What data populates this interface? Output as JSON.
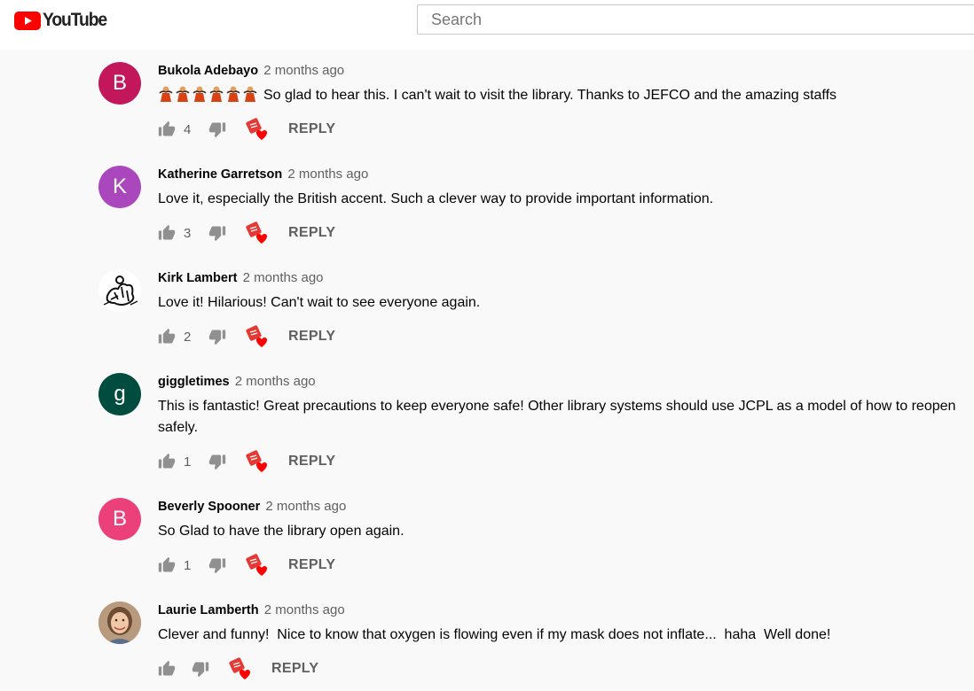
{
  "header": {
    "logo_text": "YouTube",
    "search_placeholder": "Search"
  },
  "labels": {
    "reply": "REPLY"
  },
  "comments": [
    {
      "avatar_letter": "B",
      "avatar_color": "#c2185b",
      "author": "Bukola Adebayo",
      "published": "2 months ago",
      "text": "So glad to hear this. I can't wait to visit the library. Thanks to JEFCO and the amazing staffs",
      "emoji_prefix": [
        "person-emoji",
        "person-emoji",
        "person-emoji",
        "person-emoji",
        "person-emoji",
        "person-emoji"
      ],
      "likes": "4"
    },
    {
      "avatar_letter": "K",
      "avatar_color": "#ab47bc",
      "author": "Katherine Garretson",
      "published": "2 months ago",
      "text": "Love it, especially the British accent. Such a clever way to provide important information.",
      "likes": "3"
    },
    {
      "avatar_letter": "",
      "avatar_color": "#ffffff",
      "avatar_image": "line-art-avatar",
      "author": "Kirk Lambert",
      "published": "2 months ago",
      "text": "Love it! Hilarious! Can't wait to see everyone again.",
      "likes": "2"
    },
    {
      "avatar_letter": "g",
      "avatar_color": "#004d40",
      "author": "giggletimes",
      "published": "2 months ago",
      "text": "This is fantastic! Great precautions to keep everyone safe! Other library systems should use JCPL as a model of how to reopen safely.",
      "likes": "1"
    },
    {
      "avatar_letter": "B",
      "avatar_color": "#ec407a",
      "author": "Beverly Spooner",
      "published": "2 months ago",
      "text": "So Glad to have the library open again.",
      "likes": "1"
    },
    {
      "avatar_letter": "",
      "avatar_color": "#c9a27a",
      "avatar_image": "photo-avatar",
      "author": "Laurie Lamberth",
      "published": "2 months ago",
      "text": "Clever and funny!  Nice to know that oxygen is flowing even if my mask does not inflate...  haha  Well done!",
      "likes": ""
    }
  ]
}
